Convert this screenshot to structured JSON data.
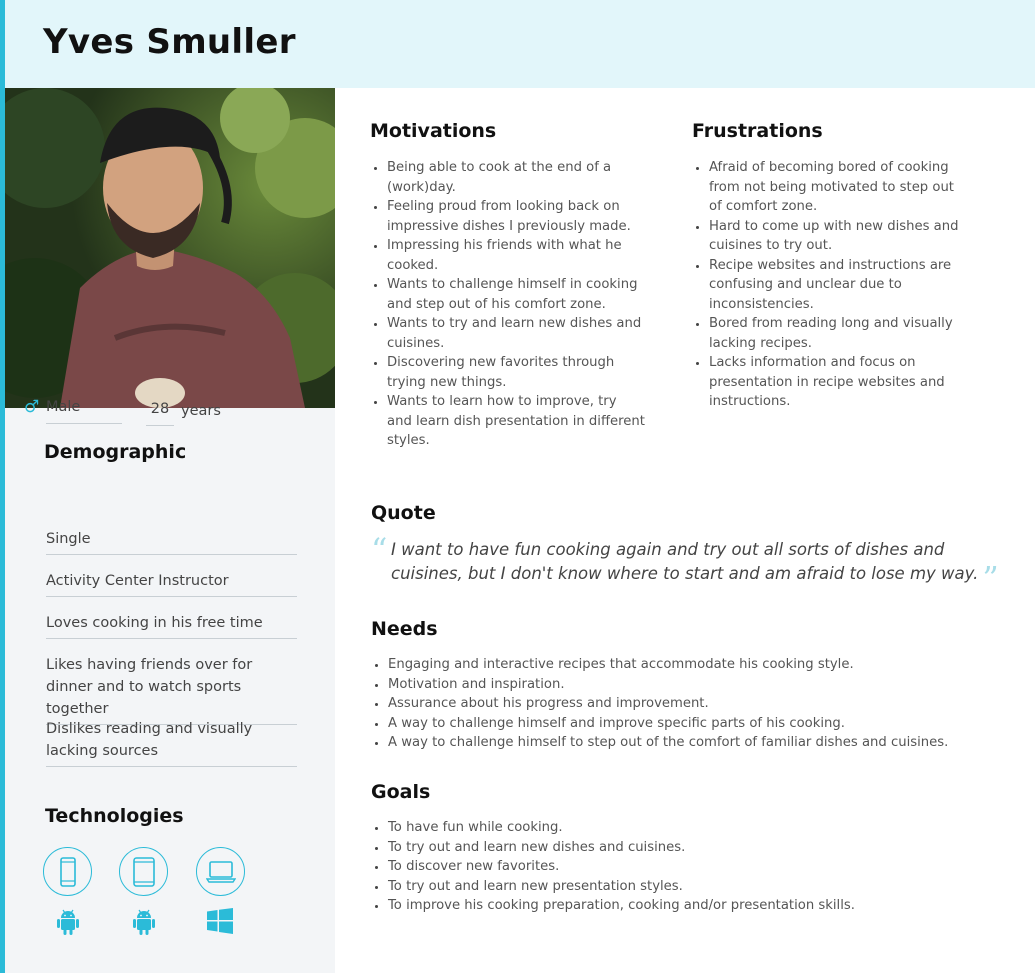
{
  "persona": {
    "name": "Yves Smuller"
  },
  "demographic": {
    "title": "Demographic",
    "gender": "Male",
    "age": "28",
    "age_unit": "years",
    "items": [
      "Single",
      "Activity Center Instructor",
      "Loves cooking in his free time",
      "Likes having friends over for dinner and to watch sports together",
      "Dislikes reading and visually lacking sources"
    ]
  },
  "technologies": {
    "title": "Technologies",
    "devices": [
      "phone-icon",
      "tablet-icon",
      "laptop-icon"
    ],
    "os": [
      "android-icon",
      "android-icon",
      "windows-icon"
    ]
  },
  "motivations": {
    "title": "Motivations",
    "items": [
      "Being able to cook at the end of a (work)day.",
      "Feeling proud from looking back on impressive dishes I previously made.",
      "Impressing his friends with what he cooked.",
      "Wants to challenge himself in cooking and step out of his comfort zone.",
      "Wants to try and learn new dishes and cuisines.",
      "Discovering new favorites through trying new things.",
      "Wants to learn how to improve, try and learn dish presentation in different styles."
    ]
  },
  "frustrations": {
    "title": "Frustrations",
    "items": [
      "Afraid of becoming bored of cooking from not being motivated to step out of comfort zone.",
      "Hard to come up with new dishes and cuisines to try out.",
      "Recipe websites and instructions are confusing and unclear due to inconsistencies.",
      "Bored from reading long and visually lacking recipes.",
      "Lacks information and focus on presentation in recipe websites and instructions."
    ]
  },
  "quote": {
    "title": "Quote",
    "text": "I want to have fun cooking again and try out all sorts of dishes and cuisines, but I don't know where to start and am afraid to lose my way."
  },
  "needs": {
    "title": "Needs",
    "items": [
      "Engaging and interactive recipes that accommodate his cooking style.",
      "Motivation and inspiration.",
      "Assurance about his progress and improvement.",
      "A way to challenge himself and improve specific parts of his cooking.",
      "A way to challenge himself to step out of the comfort of familiar dishes and cuisines."
    ]
  },
  "goals": {
    "title": "Goals",
    "items": [
      "To have fun while cooking.",
      "To try out and learn new dishes and cuisines.",
      "To discover new favorites.",
      "To try out and learn new presentation styles.",
      "To improve his cooking preparation, cooking and/or presentation skills."
    ]
  },
  "colors": {
    "accent": "#2bbbd8",
    "header_bg": "#e2f6fa",
    "sidebar_bg": "#f3f5f7"
  }
}
